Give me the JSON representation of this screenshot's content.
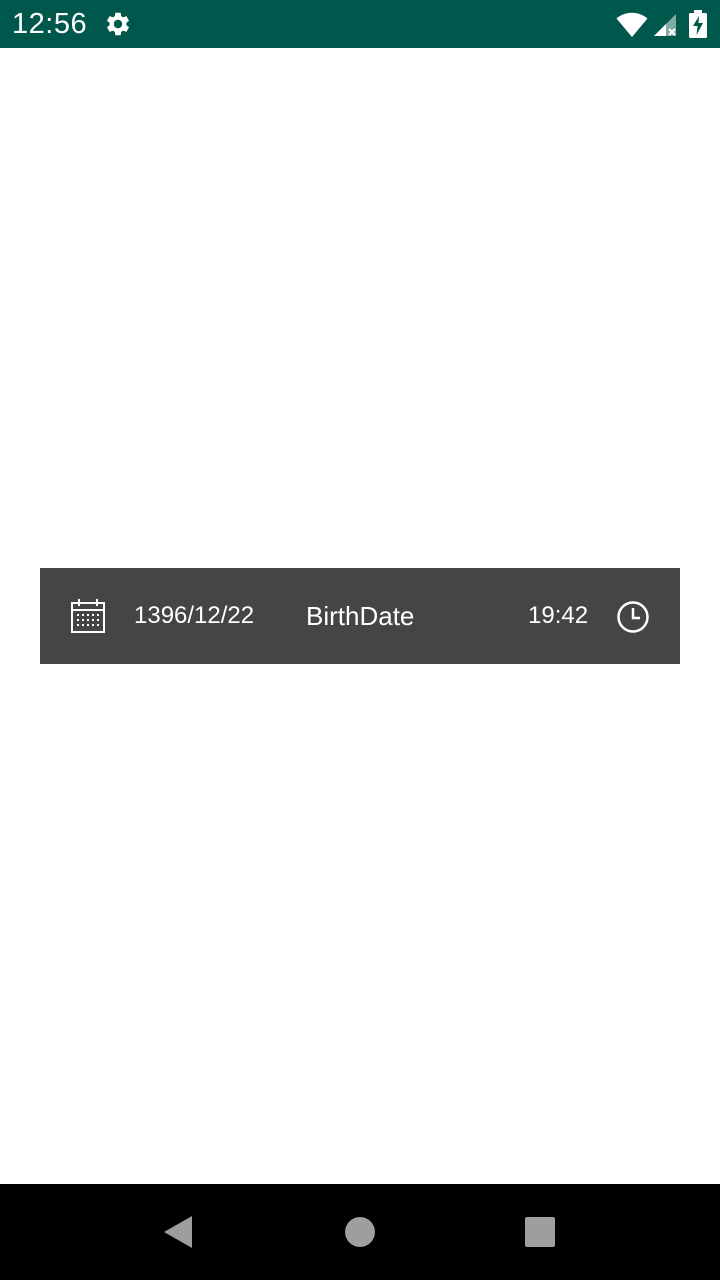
{
  "status_bar": {
    "time": "12:56",
    "background_color": "#00574b",
    "icons": [
      "gear-icon",
      "wifi-icon",
      "cell-signal-icon",
      "battery-charging-icon"
    ]
  },
  "picker": {
    "date": "1396/12/22",
    "title": "BirthDate",
    "time": "19:42",
    "background_color": "#454545",
    "icons": [
      "calendar-icon",
      "clock-icon"
    ]
  },
  "nav_bar": {
    "icons": [
      "back-icon",
      "home-icon",
      "recents-icon"
    ]
  }
}
